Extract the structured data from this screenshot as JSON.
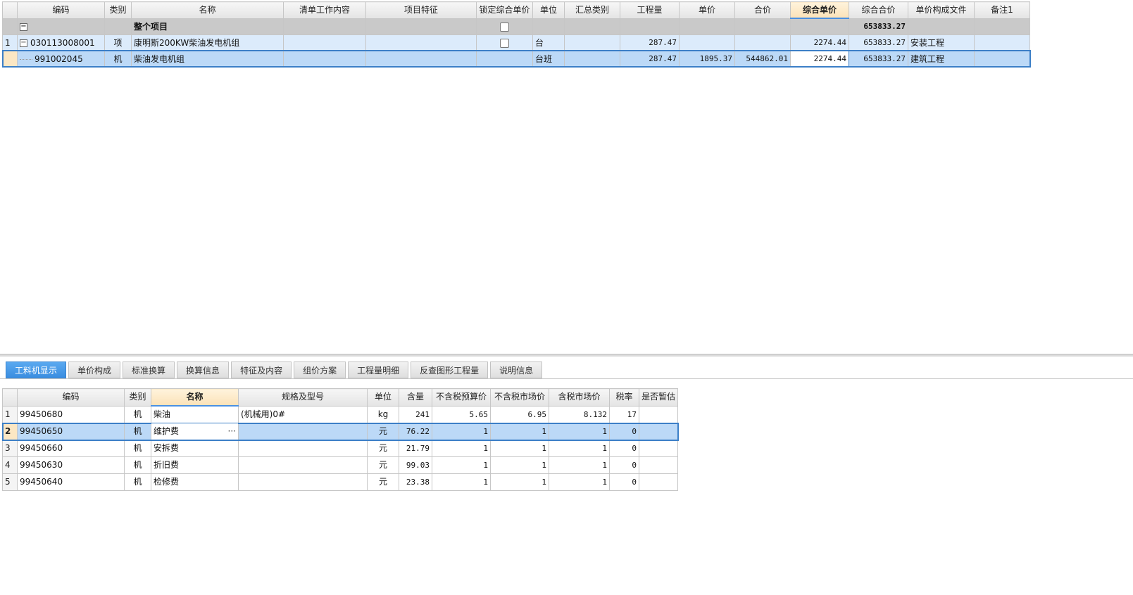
{
  "top_grid": {
    "headers": [
      "",
      "编码",
      "类别",
      "名称",
      "清单工作内容",
      "项目特征",
      "锁定综合单价",
      "单位",
      "汇总类别",
      "工程量",
      "单价",
      "合价",
      "综合单价",
      "综合合价",
      "单价构成文件",
      "备注1"
    ],
    "sorted_header": "综合单价",
    "total_row": {
      "expander": "−",
      "name": "整个项目",
      "composite_total": "653833.27"
    },
    "item_row": {
      "rownum": "1",
      "expander": "−",
      "code": "030113008001",
      "type": "项",
      "name": "康明斯200KW柴油发电机组",
      "unit": "台",
      "quantity": "287.47",
      "composite_price": "2274.44",
      "composite_total": "653833.27",
      "price_file": "安装工程"
    },
    "sub_row": {
      "code": "991002045",
      "type": "机",
      "name": "柴油发电机组",
      "unit": "台班",
      "quantity": "287.47",
      "unit_price": "1895.37",
      "total_price": "544862.01",
      "composite_price": "2274.44",
      "composite_total": "653833.27",
      "price_file": "建筑工程"
    }
  },
  "tabs": [
    "工料机显示",
    "单价构成",
    "标准换算",
    "换算信息",
    "特征及内容",
    "组价方案",
    "工程量明细",
    "反查图形工程量",
    "说明信息"
  ],
  "active_tab": "工料机显示",
  "bottom_grid": {
    "headers": [
      "",
      "编码",
      "类别",
      "名称",
      "规格及型号",
      "单位",
      "含量",
      "不含税预算价",
      "不含税市场价",
      "含税市场价",
      "税率",
      "是否暂估"
    ],
    "sorted_header": "名称",
    "rows": [
      {
        "n": "1",
        "code": "99450680",
        "type": "机",
        "name": "柴油",
        "spec": "(机械用)0#",
        "unit": "kg",
        "qty": "241",
        "budget": "5.65",
        "market": "6.95",
        "market_tax": "8.132",
        "rate": "17",
        "est": ""
      },
      {
        "n": "2",
        "code": "99450650",
        "type": "机",
        "name": "维护费",
        "spec": "",
        "unit": "元",
        "qty": "76.22",
        "budget": "1",
        "market": "1",
        "market_tax": "1",
        "rate": "0",
        "est": "",
        "ellipsis": "···"
      },
      {
        "n": "3",
        "code": "99450660",
        "type": "机",
        "name": "安拆费",
        "spec": "",
        "unit": "元",
        "qty": "21.79",
        "budget": "1",
        "market": "1",
        "market_tax": "1",
        "rate": "0",
        "est": ""
      },
      {
        "n": "4",
        "code": "99450630",
        "type": "机",
        "name": "折旧费",
        "spec": "",
        "unit": "元",
        "qty": "99.03",
        "budget": "1",
        "market": "1",
        "market_tax": "1",
        "rate": "0",
        "est": ""
      },
      {
        "n": "5",
        "code": "99450640",
        "type": "机",
        "name": "检修费",
        "spec": "",
        "unit": "元",
        "qty": "23.38",
        "budget": "1",
        "market": "1",
        "market_tax": "1",
        "rate": "0",
        "est": ""
      }
    ]
  }
}
